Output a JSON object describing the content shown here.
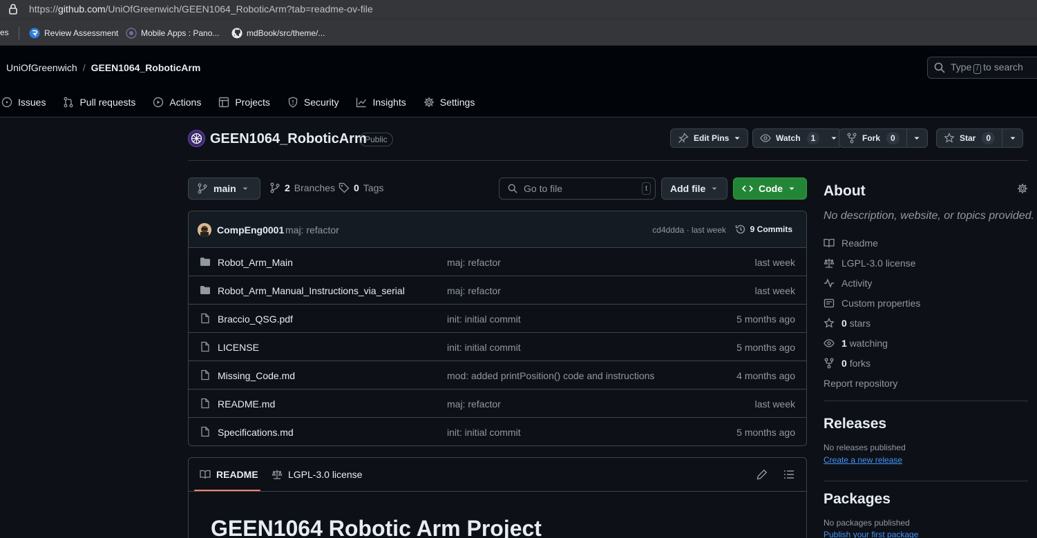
{
  "browser": {
    "url_prefix": "https://",
    "url_host": "github.com",
    "url_path": "/UniOfGreenwich/GEEN1064_RoboticArm?tab=readme-ov-file",
    "bookmarks": [
      {
        "label": "es"
      },
      {
        "label": "Review Assessment"
      },
      {
        "label": "Mobile Apps : Pano..."
      },
      {
        "label": "mdBook/src/theme/..."
      }
    ]
  },
  "header": {
    "owner": "UniOfGreenwich",
    "separator": "/",
    "repo": "GEEN1064_RoboticArm",
    "search_type": "Type",
    "search_key": "/",
    "search_to": "to search"
  },
  "nav": [
    {
      "label": "Issues",
      "icon": "issue-icon"
    },
    {
      "label": "Pull requests",
      "icon": "pull-request-icon"
    },
    {
      "label": "Actions",
      "icon": "actions-icon"
    },
    {
      "label": "Projects",
      "icon": "projects-icon"
    },
    {
      "label": "Security",
      "icon": "shield-icon"
    },
    {
      "label": "Insights",
      "icon": "graph-icon"
    },
    {
      "label": "Settings",
      "icon": "gear-icon"
    }
  ],
  "repo": {
    "title": "GEEN1064_RoboticArm",
    "visibility": "Public",
    "edit_pins": "Edit Pins",
    "watch": "Watch",
    "watch_count": "1",
    "fork": "Fork",
    "fork_count": "0",
    "star": "Star",
    "star_count": "0"
  },
  "toolbar": {
    "branch": "main",
    "branches_count": "2",
    "branches_label": "Branches",
    "tags_count": "0",
    "tags_label": "Tags",
    "goto_placeholder": "Go to file",
    "goto_key": "t",
    "add_file": "Add file",
    "code": "Code"
  },
  "latest_commit": {
    "author": "CompEng0001",
    "message": "maj: refactor",
    "sha_time": "cd4ddda · last week",
    "commits": "9 Commits"
  },
  "files": [
    {
      "type": "folder",
      "name": "Robot_Arm_Main",
      "message": "maj: refactor",
      "time": "last week"
    },
    {
      "type": "folder",
      "name": "Robot_Arm_Manual_Instructions_via_serial",
      "message": "maj: refactor",
      "time": "last week"
    },
    {
      "type": "file",
      "name": "Braccio_QSG.pdf",
      "message": "init: initial commit",
      "time": "5 months ago"
    },
    {
      "type": "file",
      "name": "LICENSE",
      "message": "init: initial commit",
      "time": "5 months ago"
    },
    {
      "type": "file",
      "name": "Missing_Code.md",
      "message": "mod: added printPosition() code and instructions",
      "time": "4 months ago"
    },
    {
      "type": "file",
      "name": "README.md",
      "message": "maj: refactor",
      "time": "last week"
    },
    {
      "type": "file",
      "name": "Specifications.md",
      "message": "init: initial commit",
      "time": "5 months ago"
    }
  ],
  "readme": {
    "tab_readme": "README",
    "tab_license": "LGPL-3.0 license",
    "heading": "GEEN1064 Robotic Arm Project"
  },
  "about": {
    "title": "About",
    "description": "No description, website, or topics provided.",
    "readme": "Readme",
    "license": "LGPL-3.0 license",
    "activity": "Activity",
    "custom_properties": "Custom properties",
    "stars_count": "0",
    "stars_label": "stars",
    "watching_count": "1",
    "watching_label": "watching",
    "forks_count": "0",
    "forks_label": "forks",
    "report": "Report repository"
  },
  "releases": {
    "title": "Releases",
    "none": "No releases published",
    "create": "Create a new release"
  },
  "packages": {
    "title": "Packages",
    "none": "No packages published",
    "publish": "Publish your first package"
  },
  "colors": {
    "bg": "#0d1117",
    "header_bg": "#010409",
    "border": "#3d444d",
    "green": "#238636",
    "link": "#4493f8",
    "tab_accent": "#f78166"
  }
}
